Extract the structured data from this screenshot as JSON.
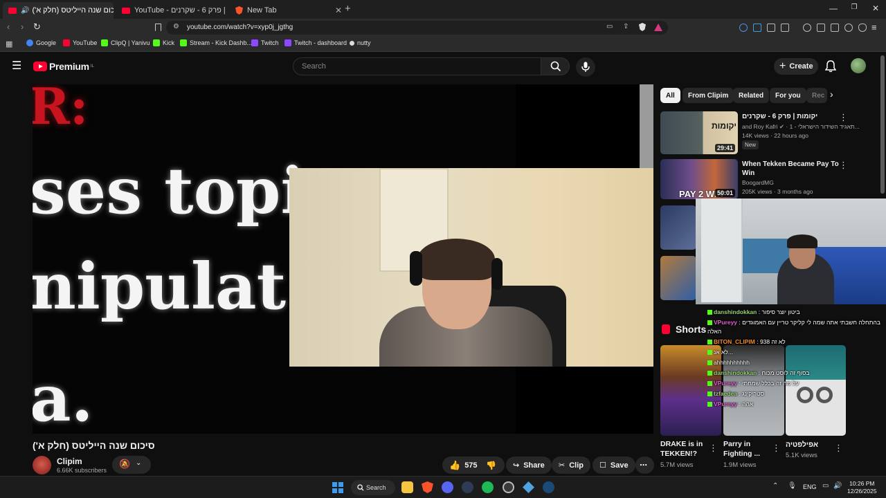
{
  "browser": {
    "tabs": [
      {
        "title": "סיכום שנה הייליטס (חלק א')",
        "active": true
      },
      {
        "title": "YouTube - יקומות | פרק 6 - שקרנים",
        "active": false
      },
      {
        "title": "New Tab",
        "active": false
      }
    ],
    "url": "youtube.com/watch?v=xyp0j_jgthg",
    "bookmarks": [
      "Google",
      "YouTube",
      "ClipQ | Yanivu",
      "Kick",
      "Stream - Kick Dashb...",
      "Twitch",
      "Twitch - dashboard",
      "nutty"
    ]
  },
  "youtube": {
    "logo_text": "Premium",
    "logo_region": "IL",
    "search_placeholder": "Search",
    "create_label": "Create"
  },
  "video": {
    "slide_lines": [
      "R:",
      "ses topi",
      "nipulat",
      "a."
    ],
    "title": "סיכום שנה הייליטס (חלק א')",
    "channel": "Clipim",
    "subscribers": "6.66K subscribers",
    "likes": "575",
    "share_label": "Share",
    "clip_label": "Clip",
    "save_label": "Save"
  },
  "sidebar": {
    "chips": [
      "All",
      "From Clipim",
      "Related",
      "For you",
      "Rec"
    ],
    "recommendations": [
      {
        "title": "יקומות | פרק 6 - שקרנים",
        "channel": "and Roy Kafri",
        "channel_extra": "· תאגיד השידור הישראלי - 1...",
        "views": "14K views · 22 hours ago",
        "badge": "New",
        "duration": "29:41",
        "thumb_text": "יקומות"
      },
      {
        "title": "When Tekken Became Pay To Win",
        "channel": "BoogardMG",
        "views": "205K views · 3 months ago",
        "duration": "50:01",
        "thumb_text": "PAY 2 WIN"
      }
    ],
    "shorts_header": "Shorts",
    "shorts": [
      {
        "title": "DRAKE is in TEKKEN!?",
        "views": "5.7M views"
      },
      {
        "title": "Parry in Fighting ...",
        "views": "1.9M views"
      },
      {
        "title": "אפילפטיה",
        "views": "5.1K views"
      }
    ]
  },
  "chat": [
    {
      "user": "danshindokkan",
      "text": ": ביטון יוצר סיפור",
      "color": "green"
    },
    {
      "user": "VPureyy",
      "text": ": בהתחלה חשבתי אתה שמה לי קליקר טריין עם האמוגדים",
      "color": "pink"
    },
    {
      "user": "",
      "text": "האלה",
      "color": "none"
    },
    {
      "user": "BITON_CLIPIM",
      "text": ": לא זה 938",
      "color": "orange"
    },
    {
      "user": "",
      "text": "לא אנ...",
      "color": "none"
    },
    {
      "user": "",
      "text": "ahhhhhhhhhh",
      "color": "none"
    },
    {
      "user": "danshindokkan",
      "text": ": בסוף זה לוסט מכוח",
      "color": "green"
    },
    {
      "user": "VPureyy",
      "text": ": על מה זה בכלל שמחתי",
      "color": "pink"
    },
    {
      "user": "tzfaedea",
      "text": ": סטריקינג",
      "color": "green"
    },
    {
      "user": "VPureyy",
      "text": ": אהה",
      "color": "pink"
    }
  ],
  "taskbar": {
    "search_label": "Search",
    "language": "ENG",
    "time": "10:26 PM",
    "date": "12/26/2025"
  }
}
